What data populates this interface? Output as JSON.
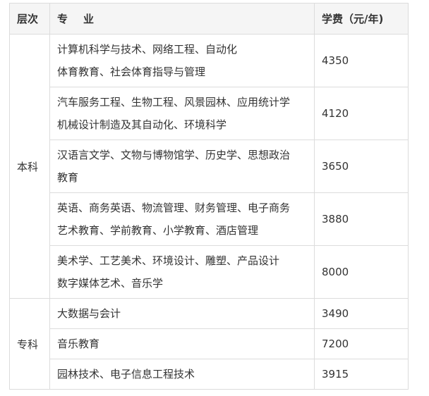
{
  "header": {
    "level": "层次",
    "major_part1": "专",
    "major_part2": "业",
    "fee": "学费（元/年)"
  },
  "groups": [
    {
      "level": "本科",
      "rows": [
        {
          "majors": [
            "计算机科学与技术、网络工程、自动化",
            "体育教育、社会体育指导与管理"
          ],
          "fee": "4350"
        },
        {
          "majors": [
            "汽车服务工程、生物工程、风景园林、应用统计学",
            "机械设计制造及其自动化、环境科学"
          ],
          "fee": "4120"
        },
        {
          "majors": [
            "汉语言文学、文物与博物馆学、历史学、思想政治",
            "教育"
          ],
          "fee": "3650"
        },
        {
          "majors": [
            "英语、商务英语、物流管理、财务管理、电子商务",
            "艺术教育、学前教育、小学教育、酒店管理"
          ],
          "fee": "3880"
        },
        {
          "majors": [
            "美术学、工艺美术、环境设计、雕塑、产品设计",
            "数字媒体艺术、音乐学"
          ],
          "fee": "8000"
        }
      ]
    },
    {
      "level": "专科",
      "rows": [
        {
          "majors": [
            "大数据与会计"
          ],
          "fee": "3490"
        },
        {
          "majors": [
            "音乐教育"
          ],
          "fee": "7200"
        },
        {
          "majors": [
            "园林技术、电子信息工程技术"
          ],
          "fee": "3915"
        }
      ]
    }
  ]
}
